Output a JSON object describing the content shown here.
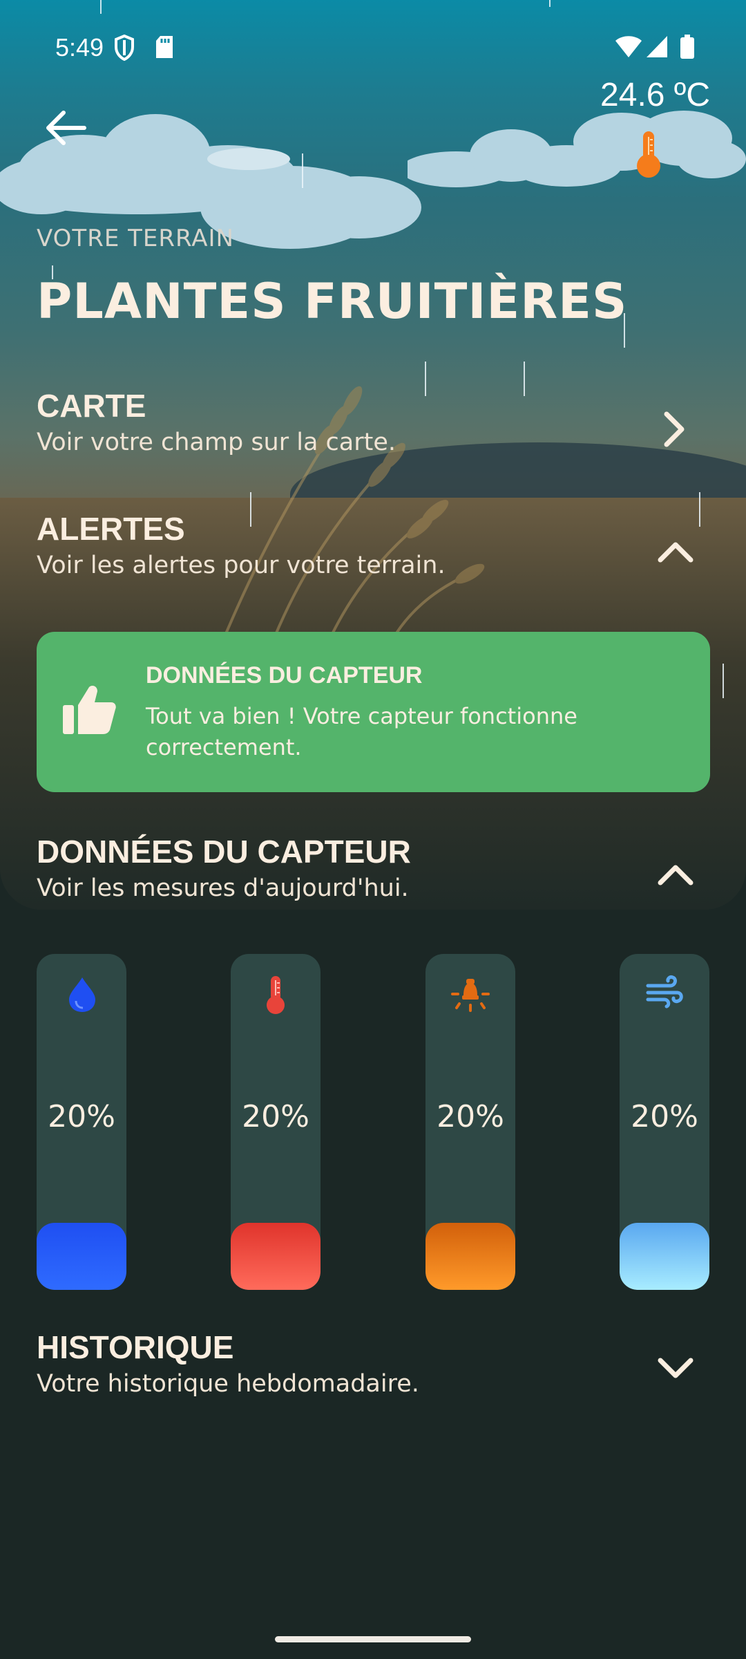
{
  "status_bar": {
    "time": "5:49"
  },
  "header": {
    "temperature": "24.6 ºC",
    "subtitle": "VOTRE TERRAIN",
    "title": "PLANTES FRUITIÈRES"
  },
  "sections": {
    "map": {
      "title": "CARTE",
      "subtitle": "Voir votre champ sur la carte."
    },
    "alerts": {
      "title": "ALERTES",
      "subtitle": "Voir les alertes pour votre terrain."
    },
    "sensor": {
      "title": "DONNÉES DU CAPTEUR",
      "subtitle": "Voir les mesures d'aujourd'hui."
    },
    "history": {
      "title": "HISTORIQUE",
      "subtitle": "Votre historique hebdomadaire."
    }
  },
  "alert_card": {
    "title": "DONNÉES DU CAPTEUR",
    "text": "Tout va bien ! Votre capteur fonctionne correctement.",
    "color": "#54b46b"
  },
  "gauges": [
    {
      "icon": "water-drop-icon",
      "value": "20%",
      "level": 0.2,
      "colors": [
        "#1f4ff2",
        "#2f6bff"
      ]
    },
    {
      "icon": "thermometer-icon",
      "value": "20%",
      "level": 0.2,
      "colors": [
        "#e0342c",
        "#ff6b5b"
      ]
    },
    {
      "icon": "light-sensor-icon",
      "value": "20%",
      "level": 0.2,
      "colors": [
        "#d2600b",
        "#ff9a2a"
      ]
    },
    {
      "icon": "wind-icon",
      "value": "20%",
      "level": 0.2,
      "colors": [
        "#5aa8f0",
        "#a8ecff"
      ]
    }
  ]
}
